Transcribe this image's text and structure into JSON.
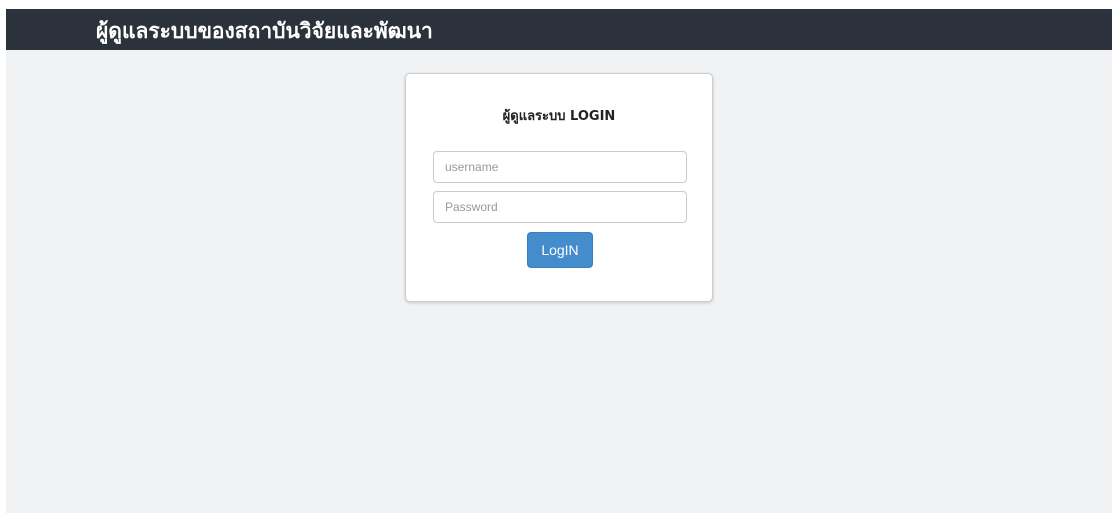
{
  "header": {
    "title": "ผู้ดูแลระบบของสถาบันวิจัยและพัฒนา"
  },
  "login": {
    "title": "ผู้ดูแลระบบ LOGIN",
    "username_placeholder": "username",
    "username_value": "",
    "password_placeholder": "Password",
    "password_value": "",
    "button_label": "LogIN"
  },
  "colors": {
    "header_bg": "#2b323b",
    "page_bg": "#f1f2f4",
    "button_bg": "#448ccb"
  }
}
